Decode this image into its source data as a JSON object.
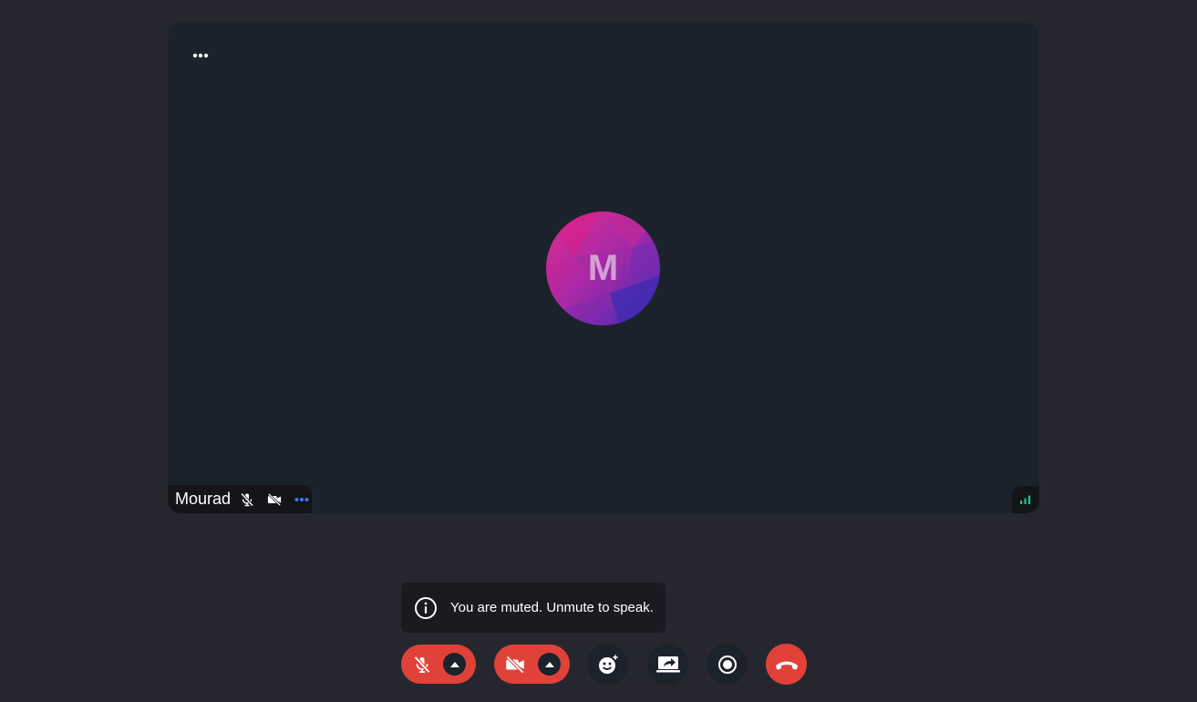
{
  "participant": {
    "name": "Mourad",
    "initial": "M",
    "audio_muted": true,
    "video_off": true
  },
  "tile_menu": {
    "icon": "more-horizontal-icon"
  },
  "connection": {
    "icon": "signal-bars-icon",
    "status_color": "#1ec78a"
  },
  "toast": {
    "icon": "info-icon",
    "message": "You are muted. Unmute to speak."
  },
  "toolbar": {
    "mic": {
      "icon": "mic-off-icon",
      "caret_icon": "caret-up-icon",
      "state": "muted"
    },
    "camera": {
      "icon": "video-off-icon",
      "caret_icon": "caret-up-icon",
      "state": "off"
    },
    "reactions": {
      "icon": "emoji-add-icon"
    },
    "share_screen": {
      "icon": "share-screen-icon"
    },
    "record": {
      "icon": "record-icon"
    },
    "leave": {
      "icon": "hang-up-icon"
    }
  },
  "colors": {
    "background": "#26272e",
    "tile": "#1b222b",
    "danger": "#e0423a",
    "accent_blue": "#2f7cf6",
    "signal_green": "#1ec78a"
  }
}
